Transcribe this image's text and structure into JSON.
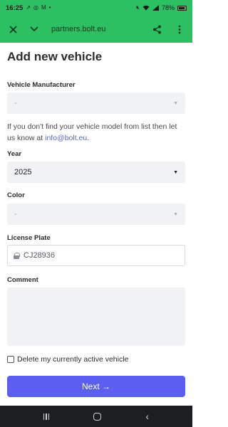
{
  "status_bar": {
    "time": "16:25",
    "notification_icons": [
      "missed-call-icon",
      "messenger-icon",
      "gmail-icon",
      "dot-icon"
    ],
    "system_icons": [
      "mute-icon",
      "wifi-icon",
      "signal-icon"
    ],
    "battery": "78%"
  },
  "browser": {
    "url": "partners.bolt.eu",
    "accent": "#2cc062"
  },
  "page": {
    "title": "Add new vehicle",
    "manufacturer": {
      "label": "Vehicle Manufacturer",
      "value": "-"
    },
    "helper": {
      "text": "If you don't find your vehicle model from list then let us know at ",
      "email": "info@bolt.eu",
      "suffix": "."
    },
    "year": {
      "label": "Year",
      "value": "2025"
    },
    "color": {
      "label": "Color",
      "value": "-"
    },
    "license_plate": {
      "label": "License Plate",
      "value": "CJ28936"
    },
    "comment": {
      "label": "Comment",
      "value": ""
    },
    "delete_checkbox": {
      "label": "Delete my currently active vehicle",
      "checked": false
    },
    "next_button": {
      "label": "Next →",
      "color": "#5b5ef0"
    }
  }
}
